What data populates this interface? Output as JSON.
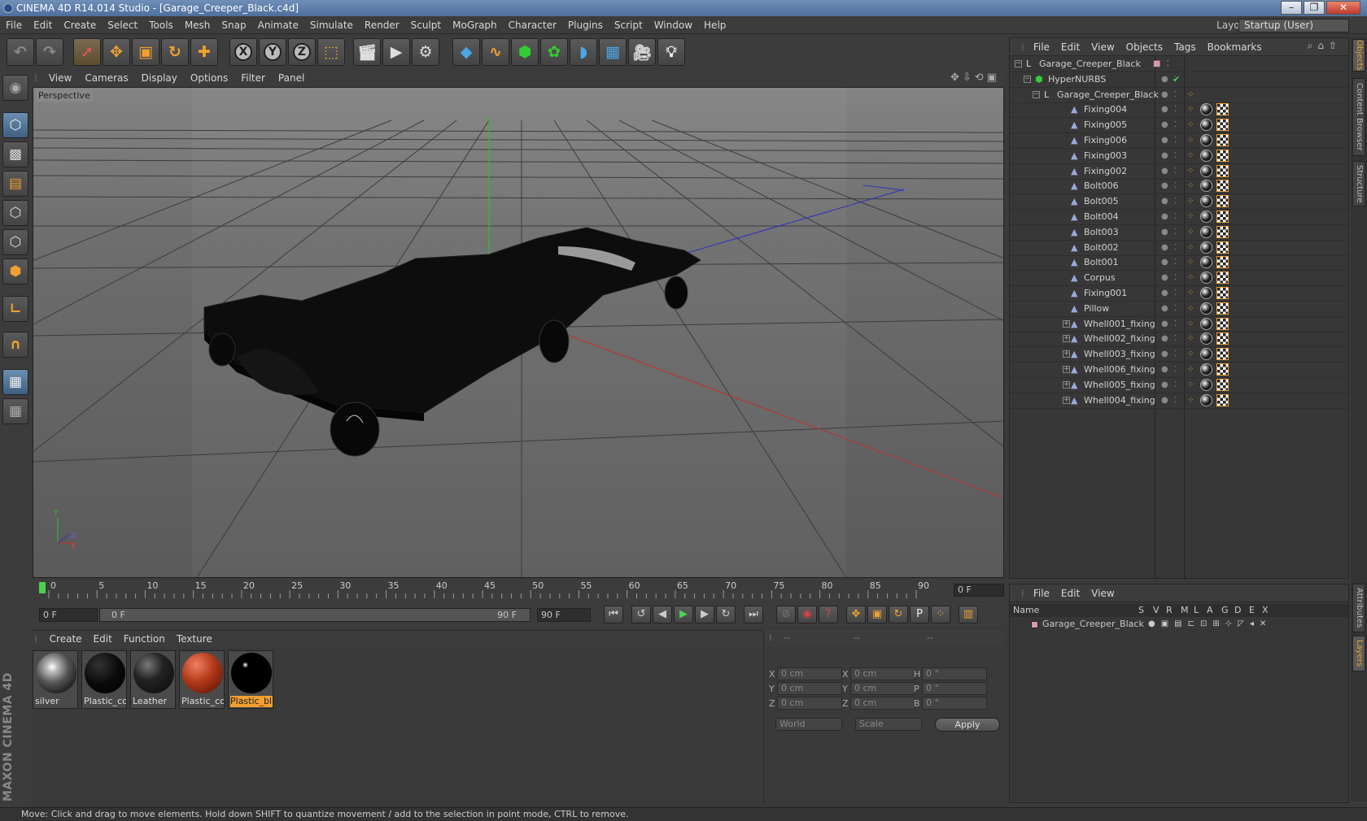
{
  "window": {
    "title": "CINEMA 4D R14.014 Studio - [Garage_Creeper_Black.c4d]"
  },
  "menu": [
    "File",
    "Edit",
    "Create",
    "Select",
    "Tools",
    "Mesh",
    "Snap",
    "Animate",
    "Simulate",
    "Render",
    "Sculpt",
    "MoGraph",
    "Character",
    "Plugins",
    "Script",
    "Window",
    "Help"
  ],
  "layout": {
    "label": "Layout:",
    "value": "Startup (User)"
  },
  "viewport": {
    "menu": [
      "View",
      "Cameras",
      "Display",
      "Options",
      "Filter",
      "Panel"
    ],
    "label": "Perspective"
  },
  "timeline": {
    "ticks": [
      "0",
      "5",
      "10",
      "15",
      "20",
      "25",
      "30",
      "35",
      "40",
      "45",
      "50",
      "55",
      "60",
      "65",
      "70",
      "75",
      "80",
      "85",
      "90"
    ],
    "current_frame": "0 F"
  },
  "transport": {
    "start": "0 F",
    "range_start": "0 F",
    "range_end": "90 F",
    "end": "90 F"
  },
  "materials": {
    "menu": [
      "Create",
      "Edit",
      "Function",
      "Texture"
    ],
    "items": [
      {
        "label": "silver"
      },
      {
        "label": "Plastic_corp"
      },
      {
        "label": "Leather"
      },
      {
        "label": "Plastic_corp"
      },
      {
        "label": "Plastic_black"
      }
    ]
  },
  "coords": {
    "header": [
      "--",
      "--",
      "--"
    ],
    "rows": [
      {
        "a": "X",
        "av": "0 cm",
        "b": "X",
        "bv": "0 cm",
        "c": "H",
        "cv": "0 °"
      },
      {
        "a": "Y",
        "av": "0 cm",
        "b": "Y",
        "bv": "0 cm",
        "c": "P",
        "cv": "0 °"
      },
      {
        "a": "Z",
        "av": "0 cm",
        "b": "Z",
        "bv": "0 cm",
        "c": "B",
        "cv": "0 °"
      }
    ],
    "mode": "World",
    "scale": "Scale",
    "apply": "Apply"
  },
  "objects": {
    "menu": [
      "File",
      "Edit",
      "View",
      "Objects",
      "Tags",
      "Bookmarks"
    ],
    "tree": [
      {
        "name": "Garage_Creeper_Black",
        "level": 0,
        "tags": false
      },
      {
        "name": "HyperNURBS",
        "level": 1,
        "tags": false
      },
      {
        "name": "Garage_Creeper_Black",
        "level": 2,
        "tags": false
      },
      {
        "name": "Fixing004",
        "level": 3,
        "tags": true
      },
      {
        "name": "Fixing005",
        "level": 3,
        "tags": true
      },
      {
        "name": "Fixing006",
        "level": 3,
        "tags": true
      },
      {
        "name": "Fixing003",
        "level": 3,
        "tags": true
      },
      {
        "name": "Fixing002",
        "level": 3,
        "tags": true
      },
      {
        "name": "Bolt006",
        "level": 3,
        "tags": true
      },
      {
        "name": "Bolt005",
        "level": 3,
        "tags": true
      },
      {
        "name": "Bolt004",
        "level": 3,
        "tags": true
      },
      {
        "name": "Bolt003",
        "level": 3,
        "tags": true
      },
      {
        "name": "Bolt002",
        "level": 3,
        "tags": true
      },
      {
        "name": "Bolt001",
        "level": 3,
        "tags": true
      },
      {
        "name": "Corpus",
        "level": 3,
        "tags": true
      },
      {
        "name": "Fixing001",
        "level": 3,
        "tags": true
      },
      {
        "name": "Pillow",
        "level": 3,
        "tags": true
      },
      {
        "name": "Whell001_fixing",
        "level": 3,
        "tags": true,
        "expand": true
      },
      {
        "name": "Whell002_fixing",
        "level": 3,
        "tags": true,
        "expand": true
      },
      {
        "name": "Whell003_fixing",
        "level": 3,
        "tags": true,
        "expand": true
      },
      {
        "name": "Whell006_fixing",
        "level": 3,
        "tags": true,
        "expand": true
      },
      {
        "name": "Whell005_fixing",
        "level": 3,
        "tags": true,
        "expand": true
      },
      {
        "name": "Whell004_fixing",
        "level": 3,
        "tags": true,
        "expand": true
      }
    ]
  },
  "layers": {
    "menu": [
      "File",
      "Edit",
      "View"
    ],
    "columns": [
      "Name",
      "S",
      "V",
      "R",
      "M",
      "L",
      "A",
      "G",
      "D",
      "E",
      "X"
    ],
    "rows": [
      {
        "name": "Garage_Creeper_Black"
      }
    ]
  },
  "side_tabs": [
    "Objects",
    "Content Browser",
    "Structure",
    "Attributes",
    "Layers"
  ],
  "brand": "MAXON CINEMA 4D",
  "status": "Move: Click and drag to move elements. Hold down SHIFT to quantize movement / add to the selection in point mode, CTRL to remove."
}
